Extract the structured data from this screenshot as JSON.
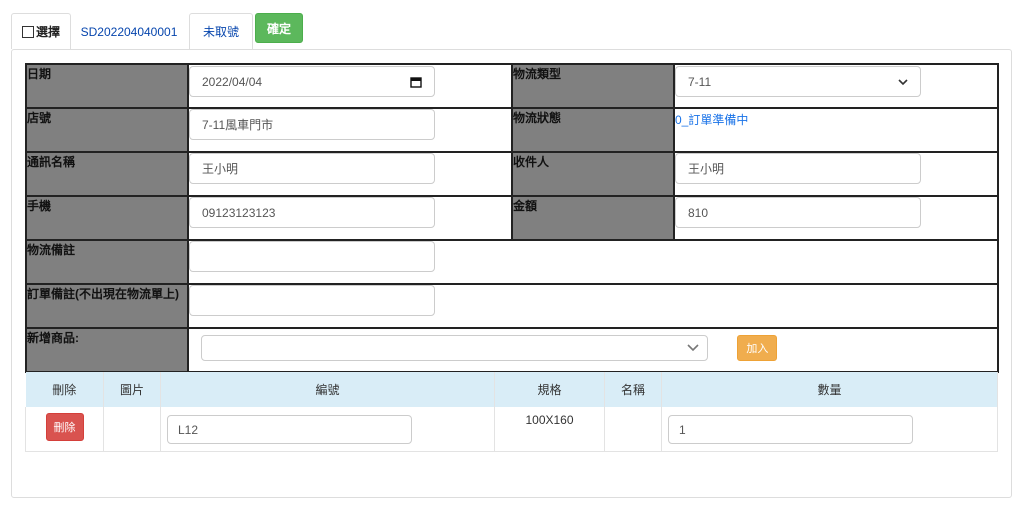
{
  "tabs": {
    "select_label": "選擇",
    "order_id": "SD202204040001",
    "unfetched": "未取號",
    "confirm": "確定"
  },
  "form": {
    "date_label": "日期",
    "date_value": "2022/04/04",
    "logistics_type_label": "物流類型",
    "logistics_type_value": "7-11",
    "store_label": "店號",
    "store_value": "7-11風車門市",
    "logistics_status_label": "物流狀態",
    "logistics_status_value": "0_訂單準備中",
    "contact_name_label": "通訊名稱",
    "contact_name_value": "王小明",
    "recipient_label": "收件人",
    "recipient_value": "王小明",
    "mobile_label": "手機",
    "mobile_value": "09123123123",
    "amount_label": "金額",
    "amount_value": "810",
    "logistics_note_label": "物流備註",
    "logistics_note_value": "",
    "order_note_label": "訂單備註(不出現在物流單上)",
    "order_note_value": "",
    "add_product_label": "新增商品:",
    "add_button": "加入"
  },
  "items": {
    "headers": [
      "刪除",
      "圖片",
      "編號",
      "規格",
      "名稱",
      "數量"
    ],
    "rows": [
      {
        "delete_label": "刪除",
        "code": "L12",
        "spec": "100X160",
        "name": "",
        "qty": "1"
      }
    ]
  },
  "icons": {
    "calendar": "calendar-icon",
    "dropdown": "chevron-down-icon"
  }
}
